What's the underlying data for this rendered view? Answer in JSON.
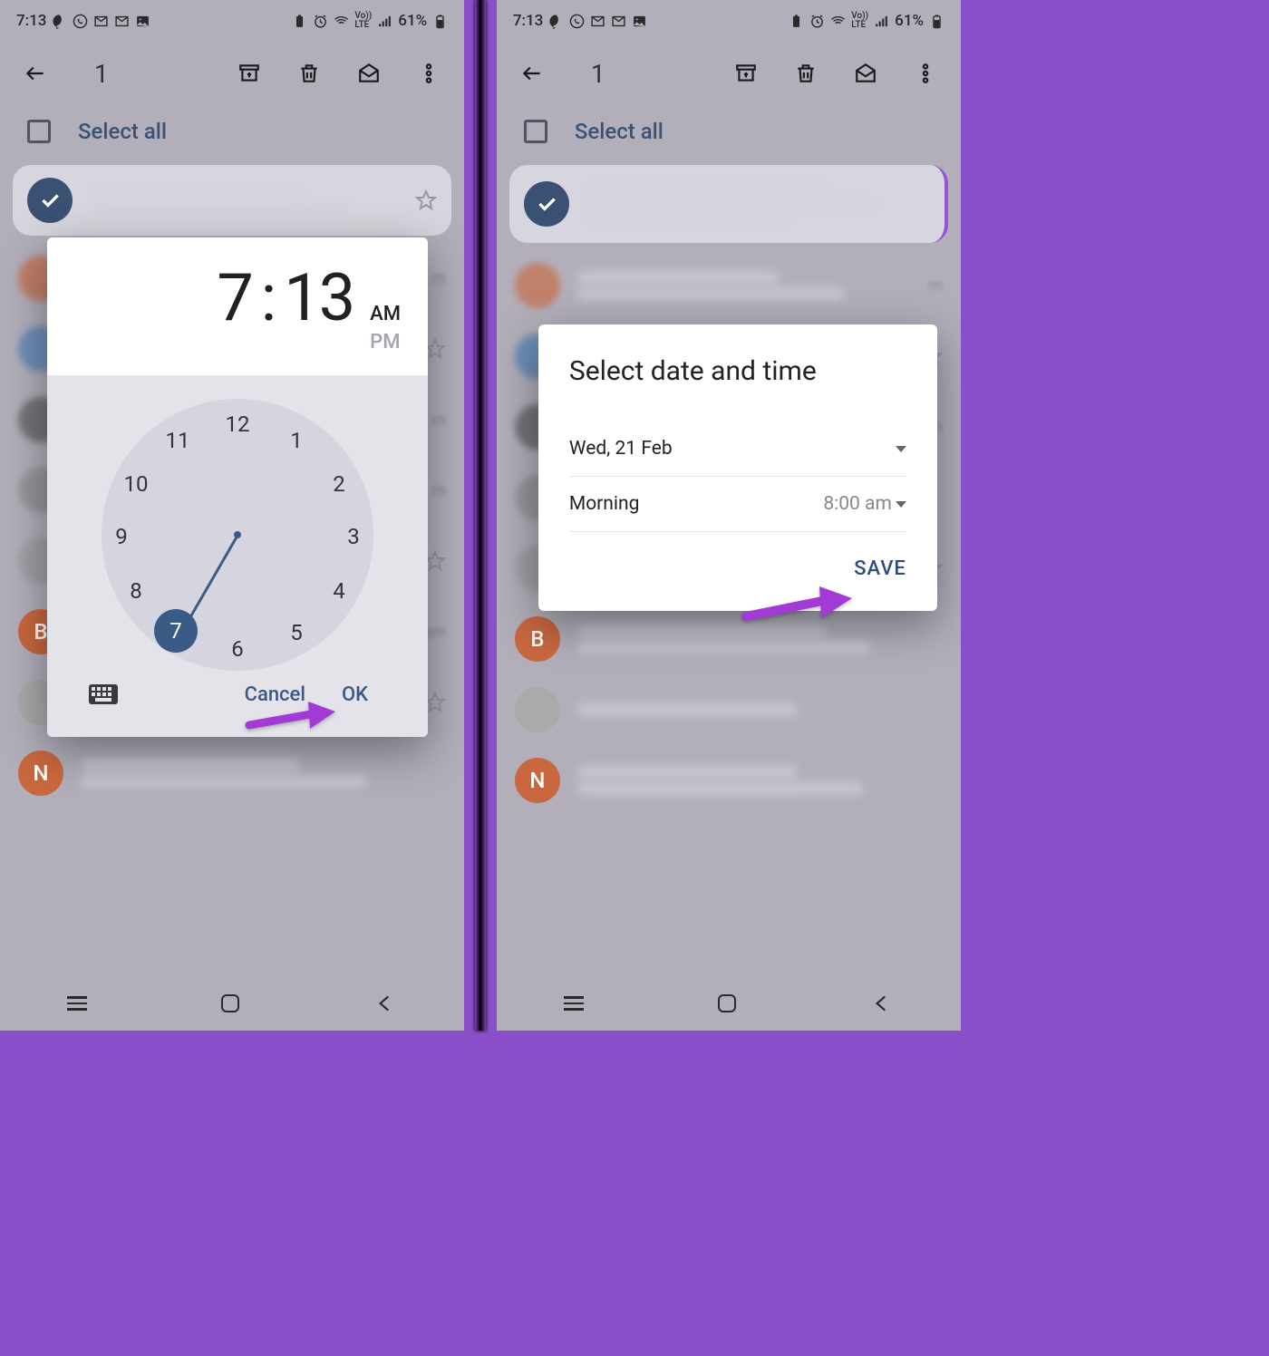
{
  "status": {
    "time": "7:13",
    "battery": "61%",
    "lte": "LTE",
    "vo": "Vo))"
  },
  "actionbar": {
    "count": "1"
  },
  "select_all": {
    "label": "Select all"
  },
  "avatars": {
    "b": "B",
    "n": "N"
  },
  "time_picker": {
    "hour": "7",
    "sep": ":",
    "minute": "13",
    "am": "AM",
    "pm": "PM",
    "numbers": [
      "12",
      "1",
      "2",
      "3",
      "4",
      "5",
      "6",
      "7",
      "8",
      "9",
      "10",
      "11"
    ],
    "selected": "7",
    "cancel": "Cancel",
    "ok": "OK"
  },
  "date_modal": {
    "title": "Select date and time",
    "date_label": "Wed, 21 Feb",
    "slot_label": "Morning",
    "slot_value": "8:00 am",
    "save": "SAVE"
  },
  "list_meta": {
    "m": "m",
    "pm": "pm"
  },
  "colors": {
    "accent": "#3b5b87",
    "arrow": "#a23ad6",
    "save": "#2d4d80"
  }
}
